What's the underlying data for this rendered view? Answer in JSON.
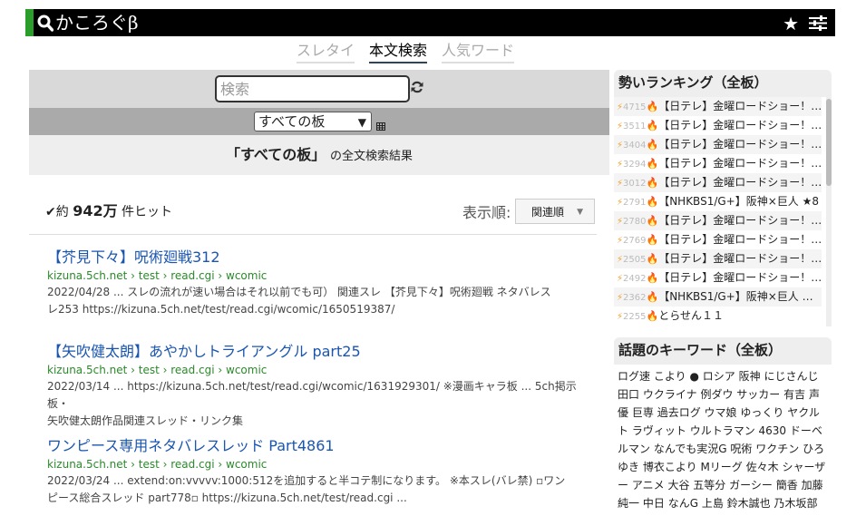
{
  "header": {
    "logo": "かころぐβ"
  },
  "tabs": [
    "スレタイ",
    "本文検索",
    "人気ワード"
  ],
  "search": {
    "placeholder": "検索",
    "board_select": "すべての板",
    "results_board": "「すべての板」",
    "results_suffix": "の全文検索結果"
  },
  "stats": {
    "prefix": "約",
    "count": "942万",
    "suffix": "件ヒット",
    "sort_label": "表示順:",
    "sort_value": "関連順"
  },
  "results": [
    {
      "title": "【芥見下々】呪術廻戦312",
      "url": "kizuna.5ch.net › test › read.cgi › wcomic",
      "snippet_line1": "2022/04/28 ... スレの流れが速い場合はそれ以前でも可） 関連スレ 【芥見下々】呪術廻戦 ネタバレス",
      "snippet_line2": "レ253 https://kizuna.5ch.net/test/read.cgi/wcomic/1650519387/"
    },
    {
      "title": "【矢吹健太朗】あやかしトライアングル part25",
      "url": "kizuna.5ch.net › test › read.cgi › wcomic",
      "snippet_line1": "2022/03/14 ... https://kizuna.5ch.net/test/read.cgi/wcomic/1631929301/ ※漫画キャラ板 ... 5ch掲示板・",
      "snippet_line2": "矢吹健太朗作品関連スレッド・リンク集"
    },
    {
      "title": "ワンピース専用ネタバレスレッド Part4861",
      "url": "kizuna.5ch.net › test › read.cgi › wcomic",
      "snippet_line1": "2022/03/24 ... extend:on:vvvvv:1000:512を追加すると半コテ制になります。 ※本スレ(バレ禁) ▫ワン",
      "snippet_line2": "ピース総合スレッド part778▫ https://kizuna.5ch.net/test/read.cgi ..."
    }
  ],
  "ranking": {
    "title": "勢いランキング（全板）",
    "items": [
      {
        "count": "4715",
        "text": "【日テレ】金曜ロードショー！…"
      },
      {
        "count": "3511",
        "text": "【日テレ】金曜ロードショー！…"
      },
      {
        "count": "3404",
        "text": "【日テレ】金曜ロードショー！…"
      },
      {
        "count": "3294",
        "text": "【日テレ】金曜ロードショー！…"
      },
      {
        "count": "3012",
        "text": "【日テレ】金曜ロードショー！…"
      },
      {
        "count": "2791",
        "text": "【NHKBS1/G+】阪神×巨人 ★8"
      },
      {
        "count": "2780",
        "text": "【日テレ】金曜ロードショー！…"
      },
      {
        "count": "2769",
        "text": "【日テレ】金曜ロードショー！…"
      },
      {
        "count": "2505",
        "text": "【日テレ】金曜ロードショー！…"
      },
      {
        "count": "2492",
        "text": "【日テレ】金曜ロードショー！…"
      },
      {
        "count": "2362",
        "text": "【NHKBS1/G+】阪神×巨人 …"
      },
      {
        "count": "2255",
        "text": "とらせん１１"
      }
    ]
  },
  "keywords": {
    "title": "話題のキーワード（全板）",
    "items": [
      "ログ速",
      "こより",
      "●",
      "ロシア",
      "阪神",
      "にじさんじ",
      "田口",
      "ウクライナ",
      "例ダウ",
      "サッカー",
      "有吉",
      "声優",
      "巨専",
      "過去ログ",
      "ウマ娘",
      "ゆっくり",
      "ヤクルト",
      "ラヴィット",
      "ウルトラマン",
      "4630",
      "ドーベルマン",
      "なんでも実況G",
      "呪術",
      "ワクチン",
      "ひろゆき",
      "博衣こより",
      "Mリーグ",
      "佐々木",
      "シャーザー",
      "アニメ",
      "大谷",
      "五等分",
      "ガーシー",
      "簡香",
      "加藤純一",
      "中日",
      "なんG",
      "上島",
      "鈴木誠也",
      "乃木坂部"
    ]
  },
  "colors": {
    "accent_green": "#2a9d2a",
    "link_blue": "#1a55b0",
    "url_green": "#2a8a2a",
    "fire": "#e33333"
  }
}
